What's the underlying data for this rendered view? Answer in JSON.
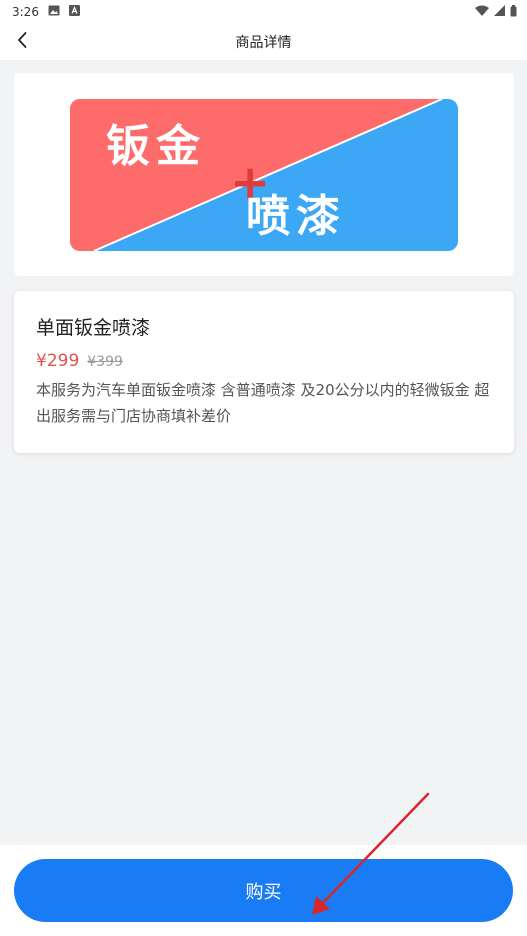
{
  "status_bar": {
    "time": "3:26",
    "left_icons": [
      "image-icon",
      "a-text-icon"
    ],
    "right_icons": [
      "wifi-icon",
      "signal-icon",
      "battery-icon"
    ]
  },
  "nav": {
    "title": "商品详情",
    "back_icon": "chevron-left-icon"
  },
  "banner": {
    "text_top": "钣金",
    "text_plus": "+",
    "text_bottom": "喷漆",
    "colors": {
      "left": "#fe6b6b",
      "right": "#3ba7f5",
      "text": "#ffffff",
      "plus": "#e03a3a"
    }
  },
  "product": {
    "name": "单面钣金喷漆",
    "price": "¥299",
    "original_price": "¥399",
    "description": "本服务为汽车单面钣金喷漆 含普通喷漆 及20公分以内的轻微钣金 超出服务需与门店协商填补差价"
  },
  "actions": {
    "buy_label": "购买"
  },
  "colors": {
    "accent": "#1a7cf5",
    "price": "#e0524b",
    "annotation": "#d9262b"
  }
}
